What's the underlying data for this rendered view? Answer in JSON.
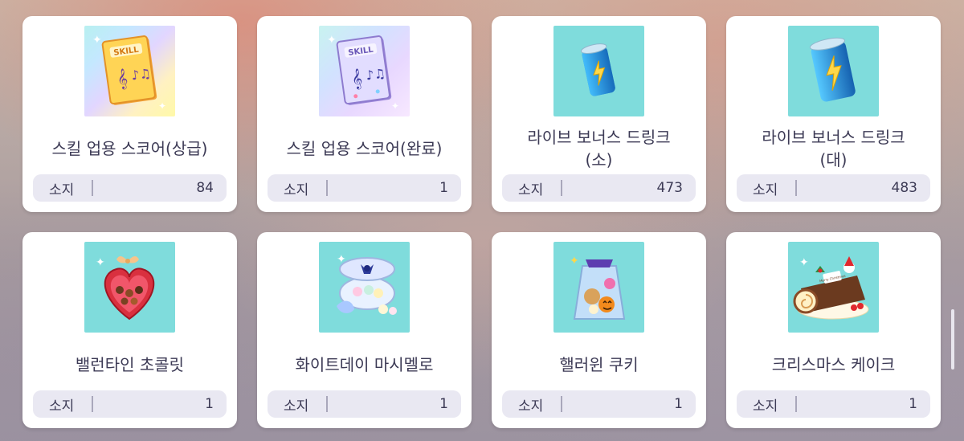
{
  "own_label": "소지",
  "items": [
    {
      "name": "스킬 업용 스코어(상급)",
      "count": "84",
      "icon": "skill-score-advanced-icon",
      "thumb_text": "SKILL"
    },
    {
      "name": "스킬 업용 스코어(완료)",
      "count": "1",
      "icon": "skill-score-complete-icon",
      "thumb_text": "SKILL"
    },
    {
      "name": "라이브 보너스 드링크\n(소)",
      "count": "473",
      "icon": "live-bonus-drink-small-icon"
    },
    {
      "name": "라이브 보너스 드링크\n(대)",
      "count": "483",
      "icon": "live-bonus-drink-large-icon"
    },
    {
      "name": "밸런타인 초콜릿",
      "count": "1",
      "icon": "valentine-chocolate-icon"
    },
    {
      "name": "화이트데이 마시멜로",
      "count": "1",
      "icon": "whiteday-marshmallow-icon"
    },
    {
      "name": "핼러윈 쿠키",
      "count": "1",
      "icon": "halloween-cookie-icon"
    },
    {
      "name": "크리스마스 케이크",
      "count": "1",
      "icon": "christmas-cake-icon",
      "thumb_text": "Merry Christmas"
    }
  ],
  "colors": {
    "thumb_bg": "#7fdcdc",
    "text": "#3c3a55",
    "own_bg": "#e9e8f2"
  }
}
